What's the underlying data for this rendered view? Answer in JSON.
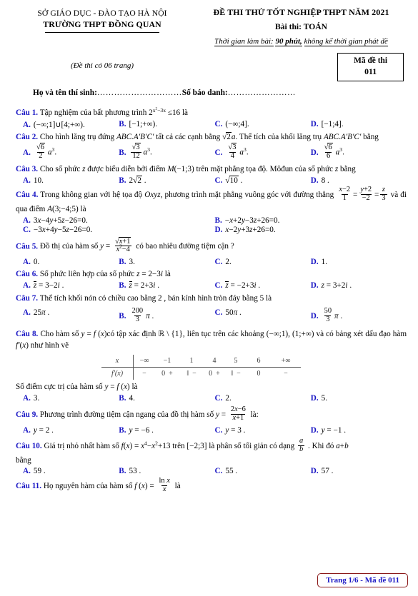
{
  "header": {
    "department": "SỞ GIÁO DỤC -  ĐÀO TẠO HÀ NỘI",
    "school": "TRƯỜNG THPT ĐỒNG QUAN",
    "exam_title": "ĐỀ THI THỬ TỐT NGHIỆP THPT NĂM 2021",
    "subject_label": "Bài thi:",
    "subject": "TOÁN",
    "duration_prefix": "Thời gian làm bài:",
    "duration_value": "90 phút,",
    "duration_suffix": "không kể thời gian phát đề",
    "pages_note": "(Đề thi có 06 trang)",
    "code_label": "Mã đề thi",
    "code_value": "011",
    "name_label": "Họ và tên thí sinh:",
    "name_dots": "…………………………",
    "sbd_label": "Số báo danh:",
    "sbd_dots": "……………………"
  },
  "questions": [
    {
      "id": "Câu 1.",
      "text_before": "Tập nghiệm của bất phương trình",
      "math": "2^(x²−3x) ≤ 16",
      "text_after": "là",
      "options": [
        "A.",
        "B.",
        "C.",
        "D."
      ],
      "option_texts": [
        "(−∞;1]∪[4;+∞).",
        "[−1;+∞).",
        "(−∞;4].",
        "[−1;4]."
      ]
    },
    {
      "id": "Câu 2.",
      "text": "Cho hình lăng trụ đứng ABC.A′B′C′ tất cả các cạnh bằng √2a. Thể tích của khối lăng trụ ABC.A′B′C′ bằng",
      "options": [
        "A.",
        "B.",
        "C.",
        "D."
      ],
      "option_texts": [
        "√6/2 a³.",
        "√3/12 a³.",
        "√3/4 a³.",
        "√6/6 a³."
      ]
    },
    {
      "id": "Câu 3.",
      "text": "Cho số phức z được biểu diễn bởi điểm M(−1;3) trên mặt phẳng tọa độ. Môđun của số phức z bằng",
      "options": [
        "A.",
        "B.",
        "C.",
        "D."
      ],
      "option_texts": [
        "10.",
        "2√2 .",
        "√10 .",
        "8 ."
      ]
    },
    {
      "id": "Câu 4.",
      "text": "Trong không gian với hệ tọa độ Oxyz, phương trình mặt phẳng vuông góc với đường thẳng (x−2)/1 = (y+2)/(−2) = z/3 và đi qua điểm A(3;−4;5) là",
      "options": [
        "A.",
        "B.",
        "C.",
        "D."
      ],
      "option_texts": [
        "3x−4y+5z−26=0.",
        "−x+2y−3z+26=0.",
        "−3x+4y−5z−26=0.",
        "x−2y+3z+26=0."
      ]
    },
    {
      "id": "Câu 5.",
      "text": "Đồ thị của hàm số y = √(x+1)/(x²−4) có bao nhiêu đường tiệm cận ?",
      "options": [
        "A.",
        "B.",
        "C.",
        "D."
      ],
      "option_texts": [
        "0.",
        "3.",
        "2.",
        "1."
      ]
    },
    {
      "id": "Câu 6.",
      "text": "Số phức liên hợp của số phức z = 2−3i là",
      "options": [
        "A.",
        "B.",
        "C.",
        "D."
      ],
      "option_texts": [
        "z̄ = 3−2i .",
        "z̄ = 2+3i .",
        "z̄ = −2+3i .",
        "z = 3+2i ."
      ]
    },
    {
      "id": "Câu 7.",
      "text": "Thể tích khối nón có chiều cao bằng 2 , bán kính hình tròn đáy bằng 5 là",
      "options": [
        "A.",
        "B.",
        "C.",
        "D."
      ],
      "option_texts": [
        "25π .",
        "200/3 π .",
        "50π .",
        "50/3 π ."
      ]
    },
    {
      "id": "Câu 8.",
      "text": "Cho hàm số y = f(x) có tập xác định ℝ\\{1}, liên tục trên các khoảng (−∞;1), (1;+∞) và có bảng xét dấu đạo hàm f′(x) như hình vẽ",
      "subquestion": "Số điểm cực trị của hàm số y = f(x) là",
      "options": [
        "A.",
        "B.",
        "C.",
        "D."
      ],
      "option_texts": [
        "3.",
        "4.",
        "2.",
        "5."
      ]
    },
    {
      "id": "Câu 9.",
      "text": "Phương trình đường tiệm cận ngang của đồ thị hàm số y = (2x−6)/(x+1) là:",
      "options": [
        "A.",
        "B.",
        "C.",
        "D."
      ],
      "option_texts": [
        "y = 2 .",
        "y = −6 .",
        "y = 3 .",
        "y = −1 ."
      ]
    },
    {
      "id": "Câu 10.",
      "text": "Giá trị nhỏ nhất hàm số f(x) = x⁴−x²+13 trên [−2;3] là phân số tối giản có dạng a/b . Khi đó a+b bằng",
      "options": [
        "A.",
        "B.",
        "C.",
        "D."
      ],
      "option_texts": [
        "59 .",
        "53 .",
        "55 .",
        "57 ."
      ]
    },
    {
      "id": "Câu 11.",
      "text": "Họ nguyên hàm của hàm số f(x) = ln x / x là"
    }
  ],
  "sign_table": {
    "row1_label": "x",
    "row2_label": "f′(x)",
    "x_values": [
      "−∞",
      "−1",
      "1",
      "4",
      "5",
      "6",
      "+∞"
    ],
    "signs": [
      "−",
      "0",
      "+",
      "‖",
      "−",
      "0",
      "+",
      "‖",
      "−",
      "0",
      "−"
    ]
  },
  "q8_sub": "Số điểm cực trị của hàm số y = f(x) là",
  "q10_bang": "bằng",
  "footer": {
    "text": "Trang 1/6 - Mã đề 011",
    "border_color": "#8b1a1a",
    "text_color": "#1a17c4"
  },
  "colors": {
    "question_label": "#1a17c4",
    "option_label": "#1a17c4",
    "body_text": "#000000"
  }
}
